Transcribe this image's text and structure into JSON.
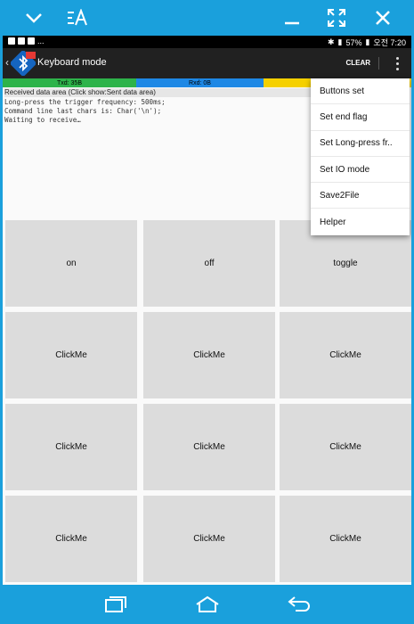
{
  "frame": {
    "colors": {
      "accent": "#1aa0dc"
    },
    "top_icons": [
      "chevron-down-icon",
      "text-size-icon",
      "minimize-icon",
      "fullscreen-icon",
      "close-icon"
    ],
    "nav_icons": [
      "recent-apps-icon",
      "home-icon",
      "back-icon"
    ]
  },
  "statusbar": {
    "left_text": "...",
    "battery": "57%",
    "time": "오전 7:20"
  },
  "appbar": {
    "title": "Keyboard mode",
    "clear_label": "CLEAR"
  },
  "counters": {
    "txd": "Txd: 35B",
    "rxd": "Rxd: 0B",
    "colors": {
      "txd": "#2db34a",
      "rxd": "#1e88e5",
      "third": "#f5d000"
    }
  },
  "receive": {
    "label": "Received data area  (Click show:Sent data area)",
    "lines": [
      "Long-press the trigger frequency: 500ms;",
      "Command line last chars is: Char('\\n');",
      "Waiting to receive…"
    ]
  },
  "buttons": [
    "on",
    "off",
    "toggle",
    "ClickMe",
    "ClickMe",
    "ClickMe",
    "ClickMe",
    "ClickMe",
    "ClickMe",
    "ClickMe",
    "ClickMe",
    "ClickMe"
  ],
  "menu": {
    "items": [
      "Buttons set",
      "Set end flag",
      "Set Long-press fr..",
      "Set IO mode",
      "Save2File",
      "Helper"
    ]
  }
}
